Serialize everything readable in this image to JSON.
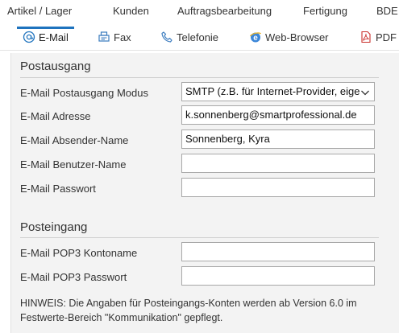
{
  "topnav": {
    "items": [
      "Artikel / Lager",
      "Kunden",
      "Auftragsbearbeitung",
      "Fertigung",
      "BDE"
    ]
  },
  "tabs": [
    {
      "label": "E-Mail",
      "icon": "at-icon",
      "active": true
    },
    {
      "label": "Fax",
      "icon": "fax-icon",
      "active": false
    },
    {
      "label": "Telefonie",
      "icon": "phone-icon",
      "active": false
    },
    {
      "label": "Web-Browser",
      "icon": "browser-icon",
      "active": false
    },
    {
      "label": "PDF",
      "icon": "pdf-icon",
      "active": false
    }
  ],
  "colors": {
    "accent": "#1e73be",
    "panel_bg": "#f3f3f3"
  },
  "outgoing": {
    "title": "Postausgang",
    "mode_label": "E-Mail Postausgang Modus",
    "mode_value": "SMTP (z.B. für Internet-Provider, eige",
    "address_label": "E-Mail Adresse",
    "address_value": "k.sonnenberg@smartprofessional.de",
    "sender_label": "E-Mail Absender-Name",
    "sender_value": "Sonnenberg, Kyra",
    "username_label": "E-Mail Benutzer-Name",
    "username_value": "",
    "password_label": "E-Mail Passwort",
    "password_value": ""
  },
  "incoming": {
    "title": "Posteingang",
    "pop3_account_label": "E-Mail POP3 Kontoname",
    "pop3_account_value": "",
    "pop3_password_label": "E-Mail POP3 Passwort",
    "pop3_password_value": ""
  },
  "hint": "HINWEIS: Die Angaben für Posteingangs-Konten werden ab Version 6.0 im Festwerte-Bereich \"Kommunikation\" gepflegt."
}
